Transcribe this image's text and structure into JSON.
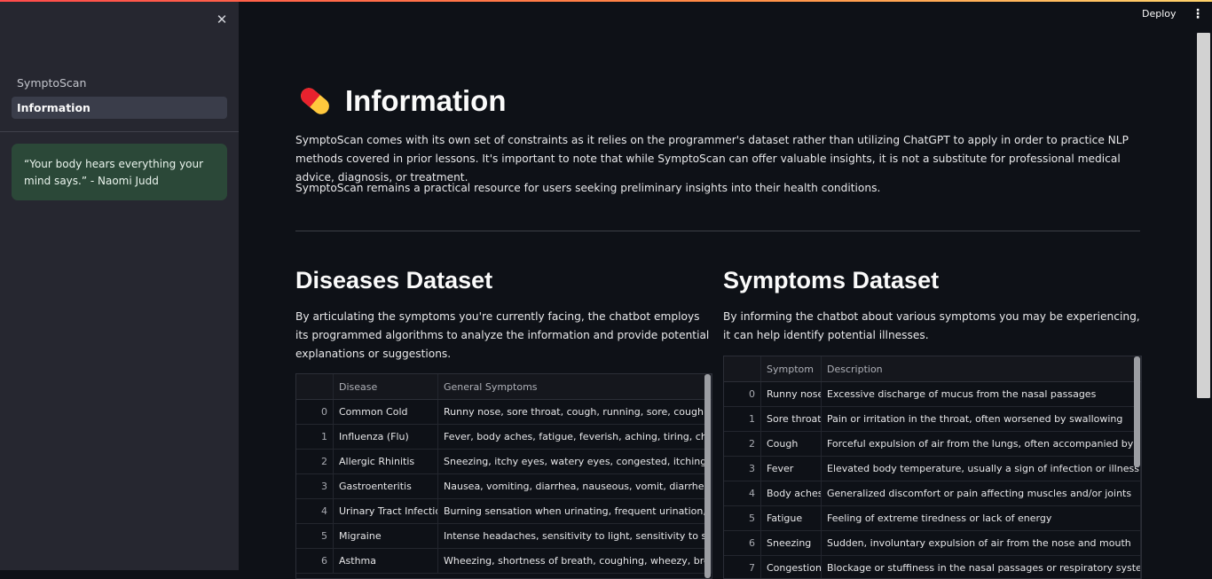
{
  "sidebar": {
    "nav": [
      "SymptoScan",
      "Information"
    ],
    "quote": "“Your body hears everything your mind says.” - Naomi Judd"
  },
  "header": {
    "deploy_label": "Deploy"
  },
  "main": {
    "title": "Information",
    "para1": "SymptoScan comes with its own set of constraints as it relies on the programmer's dataset rather than utilizing ChatGPT to apply in order to practice NLP methods covered in prior lessons. It's important to note that while SymptoScan can offer valuable insights, it is not a substitute for professional medical advice, diagnosis, or treatment.",
    "para2": "SymptoScan remains a practical resource for users seeking preliminary insights into their health conditions.",
    "diseases": {
      "heading": "Diseases Dataset",
      "description": "By articulating the symptoms you're currently facing, the chatbot employs its programmed algorithms to analyze the information and provide potential explanations or suggestions.",
      "columns": [
        "",
        "Disease",
        "General Symptoms"
      ],
      "rows": [
        [
          "0",
          "Common Cold",
          "Runny nose, sore throat, cough, running, sore, coughing, sneezi"
        ],
        [
          "1",
          "Influenza (Flu)",
          "Fever, body aches, fatigue, feverish, aching, tiring, chills, weakne"
        ],
        [
          "2",
          "Allergic Rhinitis",
          "Sneezing, itchy eyes, watery eyes, congested, itching, watering,"
        ],
        [
          "3",
          "Gastroenteritis",
          "Nausea, vomiting, diarrhea, nauseous, vomit, diarrheal, abdomi"
        ],
        [
          "4",
          "Urinary Tract Infection",
          "Burning sensation when urinating, frequent urination, burning,"
        ],
        [
          "5",
          "Migraine",
          "Intense headaches, sensitivity to light, sensitivity to sound, naus"
        ],
        [
          "6",
          "Asthma",
          "Wheezing, shortness of breath, coughing, wheezy, breathless, ch"
        ]
      ]
    },
    "symptoms": {
      "heading": "Symptoms Dataset",
      "description": "By informing the chatbot about various symptoms you may be experiencing, it can help identify potential illnesses.",
      "columns": [
        "",
        "Symptom",
        "Description"
      ],
      "rows": [
        [
          "0",
          "Runny nose",
          "Excessive discharge of mucus from the nasal passages"
        ],
        [
          "1",
          "Sore throat",
          "Pain or irritation in the throat, often worsened by swallowing"
        ],
        [
          "2",
          "Cough",
          "Forceful expulsion of air from the lungs, often accompanied by a distinctive"
        ],
        [
          "3",
          "Fever",
          "Elevated body temperature, usually a sign of infection or illness"
        ],
        [
          "4",
          "Body aches",
          "Generalized discomfort or pain affecting muscles and/or joints"
        ],
        [
          "5",
          "Fatigue",
          "Feeling of extreme tiredness or lack of energy"
        ],
        [
          "6",
          "Sneezing",
          "Sudden, involuntary expulsion of air from the nose and mouth"
        ],
        [
          "7",
          "Congestion",
          "Blockage or stuffiness in the nasal passages or respiratory system"
        ]
      ]
    }
  }
}
